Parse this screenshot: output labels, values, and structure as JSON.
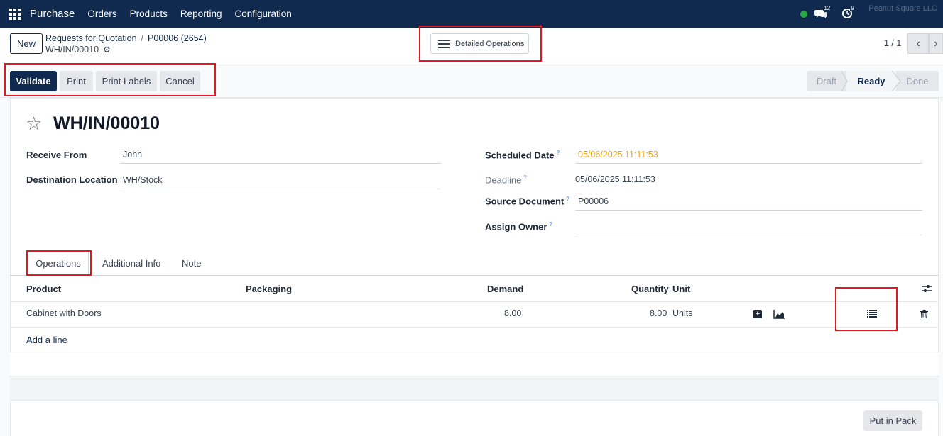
{
  "navbar": {
    "brand": "Purchase",
    "menu": [
      "Orders",
      "Products",
      "Reporting",
      "Configuration"
    ],
    "messages_count": "12",
    "activities_count": "9",
    "company": "Peanut Square LLC",
    "status_color": "#28a745"
  },
  "control": {
    "new_label": "New",
    "breadcrumb": [
      "Requests for Quotation",
      "P00006 (2654)"
    ],
    "record_ref": "WH/IN/00010",
    "detailed_label": "Detailed Operations",
    "pager": "1 / 1"
  },
  "actions": {
    "validate": "Validate",
    "print": "Print",
    "print_labels": "Print Labels",
    "cancel": "Cancel"
  },
  "stages": [
    "Draft",
    "Ready",
    "Done"
  ],
  "active_stage": "Ready",
  "form": {
    "title": "WH/IN/00010",
    "receive_from_label": "Receive From",
    "receive_from": "John",
    "destination_label": "Destination Location",
    "destination": "WH/Stock",
    "scheduled_date_label": "Scheduled Date",
    "scheduled_date": "05/06/2025 11:11:53",
    "deadline_label": "Deadline",
    "deadline": "05/06/2025 11:11:53",
    "source_doc_label": "Source Document",
    "source_doc": "P00006",
    "assign_owner_label": "Assign Owner",
    "assign_owner": ""
  },
  "tabs": [
    "Operations",
    "Additional Info",
    "Note"
  ],
  "table": {
    "columns": [
      "Product",
      "Packaging",
      "Demand",
      "Quantity",
      "Unit"
    ],
    "rows": [
      {
        "product": "Cabinet with Doors",
        "packaging": "",
        "demand": "8.00",
        "quantity": "8.00",
        "unit": "Units"
      }
    ],
    "add_line": "Add a line"
  },
  "put_in_pack": "Put in Pack",
  "colors": {
    "navbar": "#0f2a4e",
    "primary": "#0f2a4e",
    "warning_date": "#e8a20c",
    "highlight": "#e01b1b"
  }
}
